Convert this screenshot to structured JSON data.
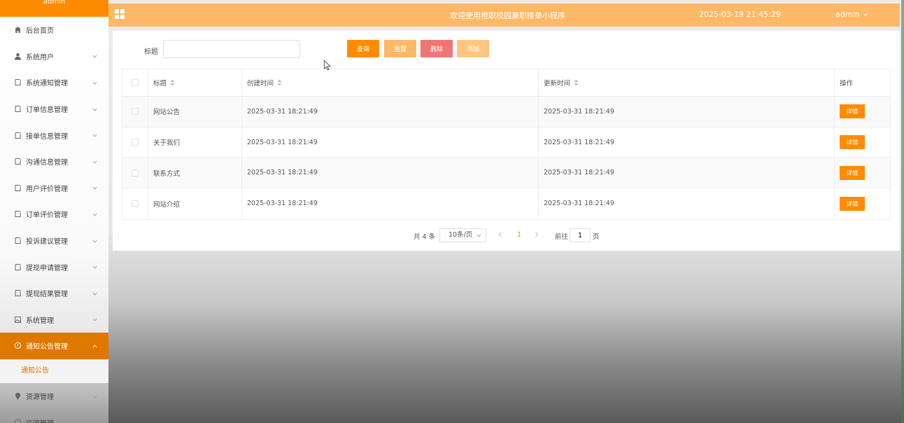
{
  "sidebar": {
    "top_label": "admin",
    "items": [
      {
        "label": "后台首页",
        "icon": "home-icon",
        "has_children": false
      },
      {
        "label": "系统用户",
        "icon": "user-icon",
        "has_children": true
      },
      {
        "label": "系统通知管理",
        "icon": "doc-icon",
        "has_children": true
      },
      {
        "label": "订单信息管理",
        "icon": "doc-icon",
        "has_children": true
      },
      {
        "label": "接单信息管理",
        "icon": "doc-icon",
        "has_children": true
      },
      {
        "label": "沟通信息管理",
        "icon": "doc-icon",
        "has_children": true
      },
      {
        "label": "用户评价管理",
        "icon": "doc-icon",
        "has_children": true
      },
      {
        "label": "订单评价管理",
        "icon": "doc-icon",
        "has_children": true
      },
      {
        "label": "投诉建议管理",
        "icon": "doc-icon",
        "has_children": true
      },
      {
        "label": "提现申请管理",
        "icon": "doc-icon",
        "has_children": true
      },
      {
        "label": "提现结果管理",
        "icon": "doc-icon",
        "has_children": true
      },
      {
        "label": "系统管理",
        "icon": "image-icon",
        "has_children": true
      },
      {
        "label": "通知公告管理",
        "icon": "info-icon",
        "has_children": true,
        "active": true
      },
      {
        "label": "资源管理",
        "icon": "pin-icon",
        "has_children": true
      },
      {
        "label": "交流管理",
        "icon": "chat-icon",
        "has_children": true
      }
    ],
    "submenu_label": "通知公告"
  },
  "header": {
    "title": "欢迎使用橙职校园兼职接单小程序",
    "datetime": "2025-03-19 21:45:29",
    "user": "admin"
  },
  "search": {
    "label": "标题",
    "value": "",
    "placeholder": ""
  },
  "buttons": {
    "query": "查询",
    "reset": "重置",
    "delete": "删除",
    "add": "添加"
  },
  "table": {
    "headers": {
      "title": "标题",
      "created": "创建时间",
      "updated": "更新时间",
      "ops": "操作"
    },
    "rows": [
      {
        "title": "网站公告",
        "created": "2025-03-31 18:21:49",
        "updated": "2025-03-31 18:21:49",
        "action": "详情"
      },
      {
        "title": "关于我们",
        "created": "2025-03-31 18:21:49",
        "updated": "2025-03-31 18:21:49",
        "action": "详情"
      },
      {
        "title": "联系方式",
        "created": "2025-03-31 18:21:49",
        "updated": "2025-03-31 18:21:49",
        "action": "详情"
      },
      {
        "title": "网站介绍",
        "created": "2025-03-31 18:21:49",
        "updated": "2025-03-31 18:21:49",
        "action": "详情"
      }
    ]
  },
  "pagination": {
    "total": "共 4 条",
    "page_size": "10条/页",
    "current_page": "1",
    "goto_prefix": "前往",
    "goto_value": "1",
    "goto_suffix": "页"
  },
  "colors": {
    "accent": "#ff8c00",
    "header_bg": "#ffb866",
    "delete": "#f07575",
    "add": "#ffc680"
  }
}
